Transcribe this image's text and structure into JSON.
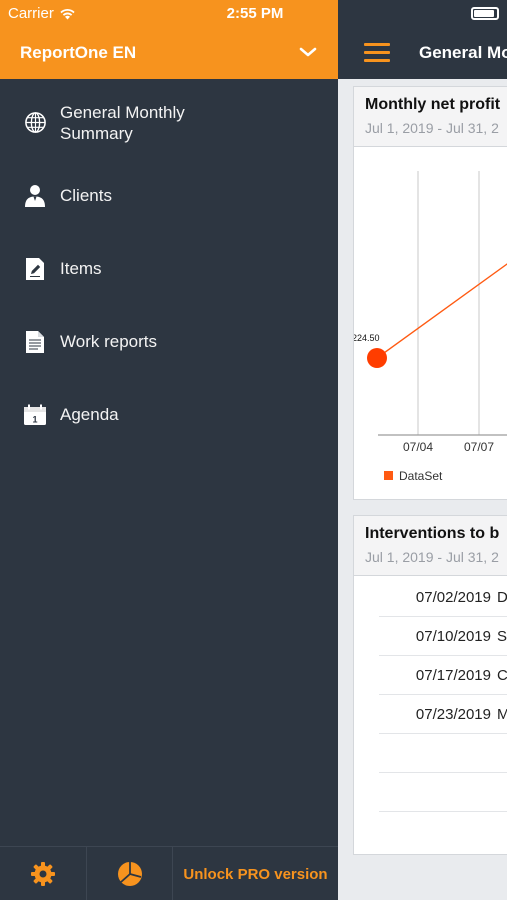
{
  "status_bar": {
    "carrier": "Carrier",
    "time": "2:55 PM"
  },
  "drawer": {
    "app_title": "ReportOne EN",
    "items": [
      {
        "label_line1": "General Monthly",
        "label_line2": "Summary",
        "icon": "globe-icon"
      },
      {
        "label": "Clients",
        "icon": "person-icon"
      },
      {
        "label": "Items",
        "icon": "edit-icon"
      },
      {
        "label": "Work reports",
        "icon": "document-icon"
      },
      {
        "label": "Agenda",
        "icon": "calendar-icon",
        "calendar_day": "1"
      }
    ],
    "footer": {
      "unlock_label": "Unlock PRO version",
      "settings_icon": "gear-icon",
      "stats_icon": "pie-chart-icon"
    }
  },
  "main": {
    "nav_title": "General Mo",
    "profit_card": {
      "title": "Monthly net profit",
      "subtitle": "Jul 1, 2019 - Jul 31, 2"
    },
    "interventions_card": {
      "title": "Interventions to b",
      "subtitle": "Jul 1, 2019 - Jul 31, 2",
      "rows": [
        {
          "date": "07/02/2019",
          "desc": "D"
        },
        {
          "date": "07/10/2019",
          "desc": "S"
        },
        {
          "date": "07/17/2019",
          "desc": "C"
        },
        {
          "date": "07/23/2019",
          "desc": "M"
        }
      ]
    }
  },
  "colors": {
    "accent": "#f7931e",
    "drawer_bg": "#2d3641",
    "series": "#ff5a12"
  },
  "chart_data": {
    "type": "line",
    "x_tick_labels": [
      "07/04",
      "07/07"
    ],
    "points": [
      {
        "x": "07/01",
        "y_label": "224.50"
      }
    ],
    "series": [
      {
        "name": "DataSet"
      }
    ],
    "legend_position": "bottom-left",
    "grid": true
  }
}
